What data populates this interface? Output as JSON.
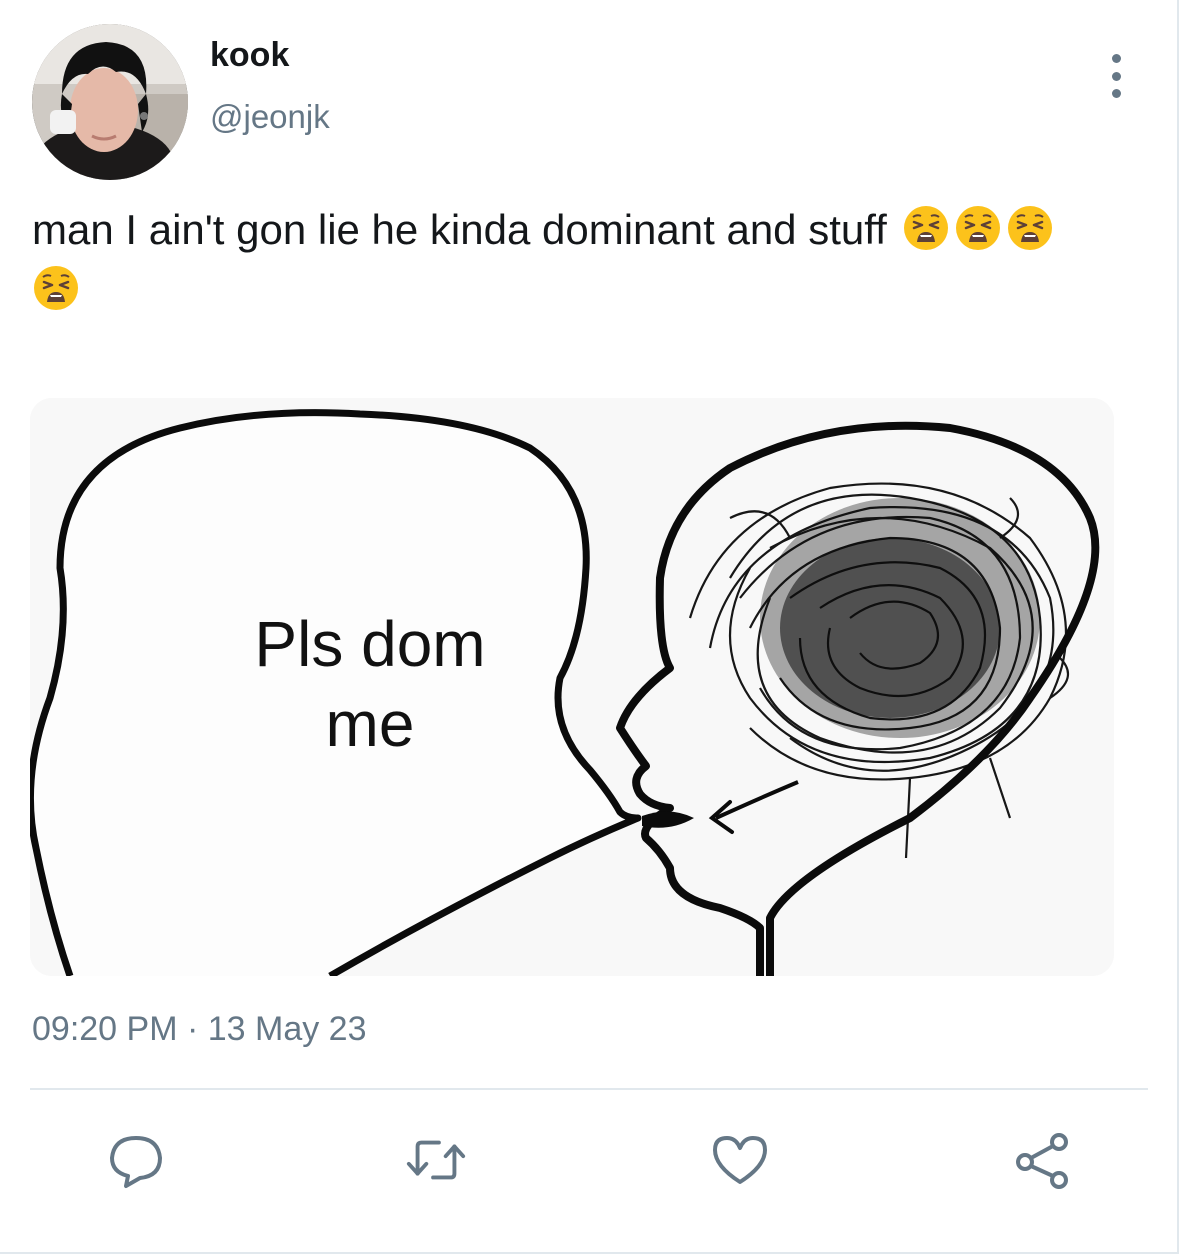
{
  "tweet": {
    "display_name": "kook",
    "handle": "@jeonjk",
    "text": "man I ain't gon lie he kinda dominant and stuff",
    "emoji": [
      "weary-face",
      "weary-face",
      "weary-face",
      "weary-face"
    ],
    "timestamp": "09:20 PM · 13 May 23",
    "media": {
      "caption_line1": "Pls dom",
      "caption_line2": "me"
    }
  },
  "actions": {
    "icons": [
      "reply-icon",
      "retweet-icon",
      "like-icon",
      "share-icon"
    ]
  },
  "colors": {
    "text": "#14171a",
    "secondary": "#657786",
    "divider": "#e1e8ed",
    "emoji": "#fcc21b"
  }
}
